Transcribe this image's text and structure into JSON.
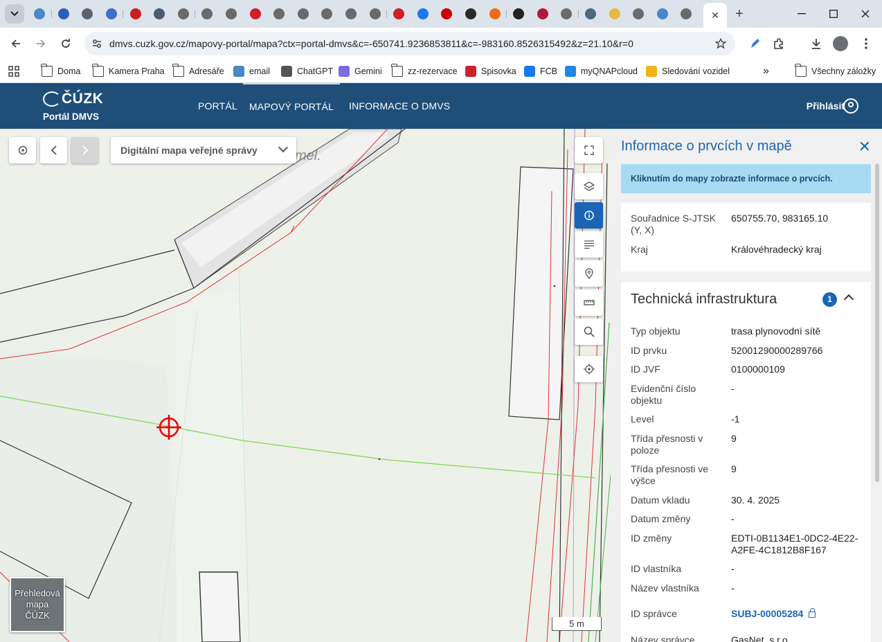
{
  "browser": {
    "active_tab_close": "✕",
    "new_tab": "+",
    "favicons": [
      {
        "icon": "drive-icon",
        "color": "#4a86c8"
      },
      {
        "icon": "doc-icon",
        "color": "#2d5fb8"
      },
      {
        "icon": "globe-icon",
        "color": "#5a6470"
      },
      {
        "icon": "doc-icon",
        "color": "#3d6fc6"
      },
      {
        "icon": "huawei-icon",
        "color": "#c82020"
      },
      {
        "icon": "globe-icon",
        "color": "#4a5a70"
      },
      {
        "icon": "chatgpt-icon",
        "color": "#6a6a6a"
      },
      {
        "icon": "chatgpt-icon",
        "color": "#6a6a6a"
      },
      {
        "icon": "chatgpt-icon",
        "color": "#6a6a6a"
      },
      {
        "icon": "t-icon",
        "color": "#d0202a"
      },
      {
        "icon": "chatgpt-icon",
        "color": "#6a6a6a"
      },
      {
        "icon": "chatgpt-icon",
        "color": "#6a6a6a"
      },
      {
        "icon": "chatgpt-icon",
        "color": "#6a6a6a"
      },
      {
        "icon": "chatgpt-icon",
        "color": "#6a6a6a"
      },
      {
        "icon": "chatgpt-icon",
        "color": "#6a6a6a"
      },
      {
        "icon": "t-icon",
        "color": "#d0202a"
      },
      {
        "icon": "facebook-icon",
        "color": "#1877f2"
      },
      {
        "icon": "cnn-icon",
        "color": "#cc0000"
      },
      {
        "icon": "list-icon",
        "color": "#2a2a2a"
      },
      {
        "icon": "orange-icon",
        "color": "#f06a1a"
      },
      {
        "icon": "dark-icon",
        "color": "#222222"
      },
      {
        "icon": "linkedin-icon",
        "color": "#b01a3a"
      },
      {
        "icon": "chatgpt-icon",
        "color": "#6a6a6a"
      },
      {
        "icon": "globe-icon",
        "color": "#4a6a80"
      },
      {
        "icon": "yellow-icon",
        "color": "#e6b84a"
      },
      {
        "icon": "chatgpt-icon",
        "color": "#6a6a6a"
      },
      {
        "icon": "drive-icon",
        "color": "#4a86c8"
      },
      {
        "icon": "chatgpt-icon",
        "color": "#6a6a6a"
      }
    ],
    "url": "dmvs.cuzk.gov.cz/mapovy-portal/mapa?ctx=portal-dmvs&c=-650741.9236853811&c=-983160.8526315492&z=21.10&r=0",
    "bookmarks": [
      {
        "label": "Doma",
        "icon": "folder-icon"
      },
      {
        "label": "Kamera Praha",
        "icon": "folder-icon"
      },
      {
        "label": "Adresáře",
        "icon": "folder-icon"
      },
      {
        "label": "email",
        "icon": "drive-icon"
      },
      {
        "label": "ChatGPT",
        "icon": "chatgpt-icon"
      },
      {
        "label": "Gemini",
        "icon": "gemini-icon"
      },
      {
        "label": "zz-rezervace",
        "icon": "folder-icon"
      },
      {
        "label": "Spisovka",
        "icon": "t-icon"
      },
      {
        "label": "FCB",
        "icon": "facebook-icon"
      },
      {
        "label": "myQNAPcloud",
        "icon": "qnap-icon"
      },
      {
        "label": "Sledování vozidel",
        "icon": "vehicle-icon"
      }
    ],
    "bookmarks_more": "»",
    "all_bookmarks": "Všechny záložky"
  },
  "header": {
    "logo": "ČÚZK",
    "subtitle": "Portál DMVS",
    "nav": [
      "PORTÁL",
      "MAPOVÝ PORTÁL",
      "INFORMACE O DMVS"
    ],
    "active_nav": "MAPOVÝ PORTÁL",
    "login": "Přihlásit"
  },
  "map": {
    "layer_select": "Digitální mapa veřejné správy",
    "map_label": "mel.",
    "scale": "5 m",
    "overview": "Přehledová mapa ČÚZK"
  },
  "panel": {
    "title": "Informace o prvcích v mapě",
    "close": "✕",
    "hint": "Kliknutím do mapy zobrazte informace o prvcích.",
    "coords": [
      {
        "key": "Souřadnice S-JTSK (Y, X)",
        "value": "650755.70, 983165.10"
      },
      {
        "key": "Kraj",
        "value": "Královéhradecký kraj"
      }
    ],
    "section": {
      "title": "Technická infrastruktura",
      "count": "1",
      "rows": [
        {
          "key": "Typ objektu",
          "value": "trasa plynovodní sítě"
        },
        {
          "key": "ID prvku",
          "value": "52001290000289766"
        },
        {
          "key": "ID JVF",
          "value": "0100000109"
        },
        {
          "key": "Evidenční číslo objektu",
          "value": "-"
        },
        {
          "key": "Level",
          "value": "-1"
        },
        {
          "key": "Třída přesnosti v poloze",
          "value": "9"
        },
        {
          "key": "Třída přesnosti ve výšce",
          "value": "9"
        },
        {
          "key": "Datum vkladu",
          "value": "30. 4. 2025"
        },
        {
          "key": "Datum změny",
          "value": "-"
        },
        {
          "key": "ID změny",
          "value": "EDTI-0B1134E1-0DC2-4E22-A2FE-4C1812B8F167"
        },
        {
          "key": "ID vlastníka",
          "value": "-"
        },
        {
          "key": "Název vlastníka",
          "value": "-"
        },
        {
          "key": "ID správce",
          "value": "SUBJ-00005284"
        },
        {
          "key": "Název správce",
          "value": "GasNet, s.r.o."
        }
      ]
    }
  }
}
